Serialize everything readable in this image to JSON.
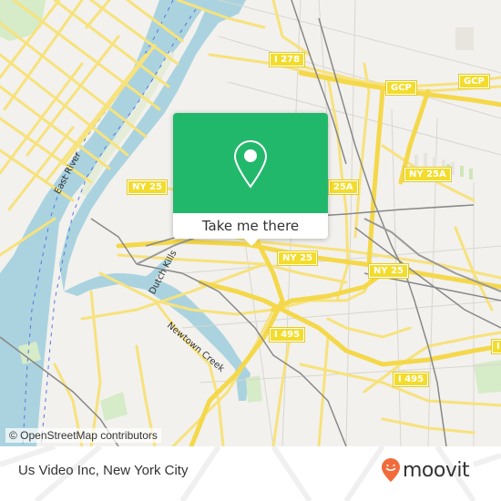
{
  "map": {
    "attribution": "© OpenStreetMap contributors",
    "colors": {
      "land": "#f2f1ed",
      "water": "#aad3df",
      "park": "#d6ebc8",
      "major_road": "#f7e27c",
      "road_outline": "#e8cf5a",
      "rail": "#777777",
      "minor_road": "#cfcdc8"
    },
    "road_shields": [
      {
        "label": "I 278"
      },
      {
        "label": "GCP"
      },
      {
        "label": "GCP"
      },
      {
        "label": "NY 25"
      },
      {
        "label": "25A"
      },
      {
        "label": "NY 25A"
      },
      {
        "label": "NY 25"
      },
      {
        "label": "NY 25"
      },
      {
        "label": "I 495"
      },
      {
        "label": "I 495"
      },
      {
        "label": "I"
      }
    ],
    "water_labels": [
      {
        "label": "East River"
      },
      {
        "label": "Dutch Kills"
      },
      {
        "label": "Newtown Creek"
      }
    ]
  },
  "popup": {
    "pin_icon": "location-pin-icon",
    "button_label": "Take me there",
    "accent_color": "#22b86b"
  },
  "footer": {
    "place_name": "Us Video Inc, New York City",
    "brand_name": "moovit",
    "brand_color": "#f26b3a"
  }
}
